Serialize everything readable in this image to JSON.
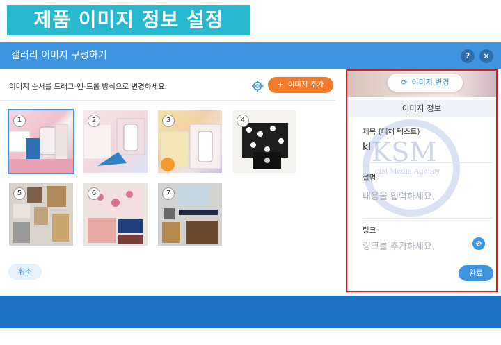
{
  "banner": {
    "title": "제품 이미지 정보 설정"
  },
  "dialog": {
    "title": "갤러리 이미지 구성하기",
    "help": "?",
    "close": "×"
  },
  "left": {
    "instruction": "이미지 순서를 드래그-앤-드롭 방식으로 변경하세요.",
    "add_button": "이미지 추가",
    "add_plus": "+",
    "cancel": "취소",
    "thumbnails": [
      {
        "num": "1",
        "icon": "gift-box-pink-image"
      },
      {
        "num": "2",
        "icon": "gift-box-fruity-image"
      },
      {
        "num": "3",
        "icon": "citrus-box-image"
      },
      {
        "num": "4",
        "icon": "damask-bag-image"
      },
      {
        "num": "5",
        "icon": "kraft-papers-image"
      },
      {
        "num": "6",
        "icon": "floral-paper-image"
      },
      {
        "num": "7",
        "icon": "packaging-items-image"
      }
    ]
  },
  "right": {
    "change_button": "이미지 변경",
    "info_title": "이미지 정보",
    "title_label": "제목 (대체 텍스트)",
    "title_value": "kl",
    "desc_label": "설명",
    "desc_placeholder": "내용을 입력하세요.",
    "link_label": "링크",
    "link_placeholder": "링크를 추가하세요.",
    "done": "완료"
  },
  "watermark": {
    "text": "KSM",
    "sub": "cial Media Agency"
  },
  "colors": {
    "accent": "#3f94e0",
    "orange": "#f47a2a",
    "banner": "#26b8cf",
    "highlight": "#e11"
  }
}
